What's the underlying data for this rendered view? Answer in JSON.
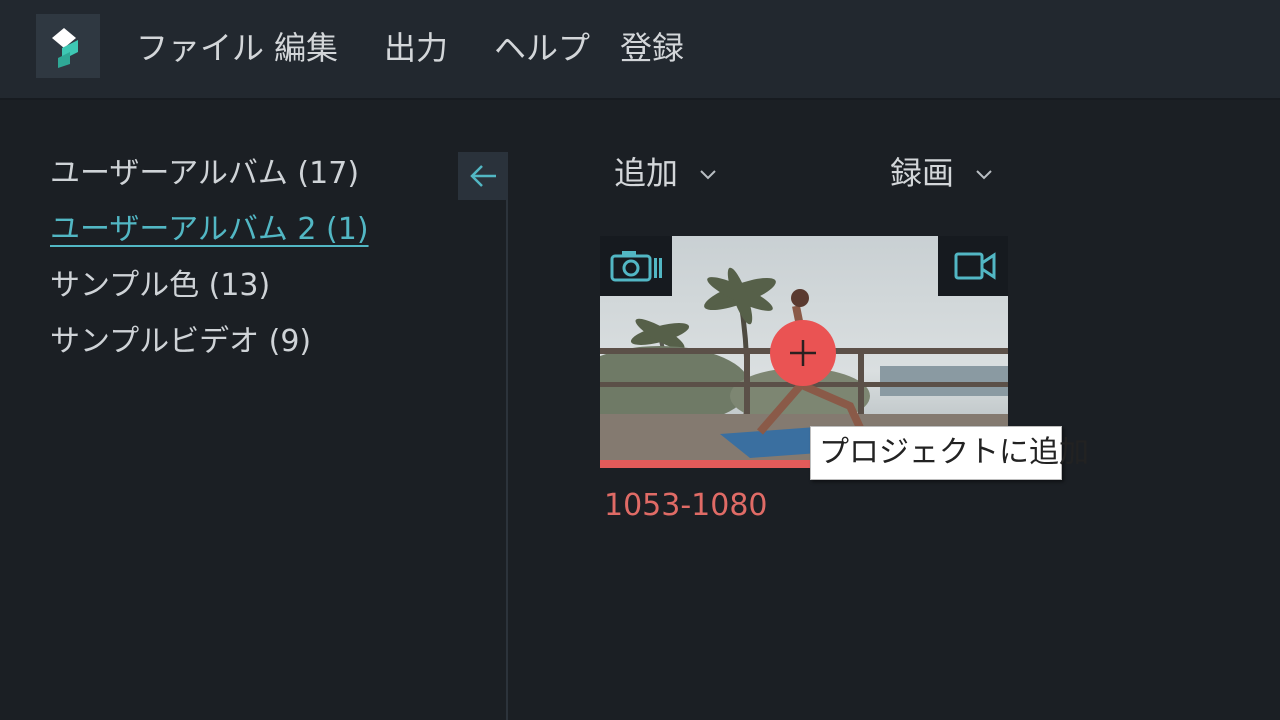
{
  "app": {
    "menu": [
      "ファイル",
      "編集",
      "出力",
      "ヘルプ",
      "登録"
    ],
    "accent_color": "#52b7c4",
    "logo_icon": "filmora-logo-icon"
  },
  "sidebar": {
    "albums": [
      {
        "label": "ユーザーアルバム (17)",
        "active": false
      },
      {
        "label": "ユーザーアルバム 2 (1)",
        "active": true
      },
      {
        "label": "サンプル色 (13)",
        "active": false
      },
      {
        "label": "サンプルビデオ (9)",
        "active": false
      }
    ],
    "collapse_icon": "arrow-left-icon"
  },
  "toolbar": {
    "add_label": "追加",
    "record_label": "録画",
    "dropdown_icon": "chevron-down-icon"
  },
  "media": {
    "items": [
      {
        "name": "1053-1080",
        "progress": 0.52,
        "type_icons": [
          "camera-icon",
          "video-camera-icon"
        ],
        "add_button_icon": "plus-icon",
        "tooltip": "プロジェクトに追加"
      }
    ],
    "progress_color": "#e25b5a"
  }
}
